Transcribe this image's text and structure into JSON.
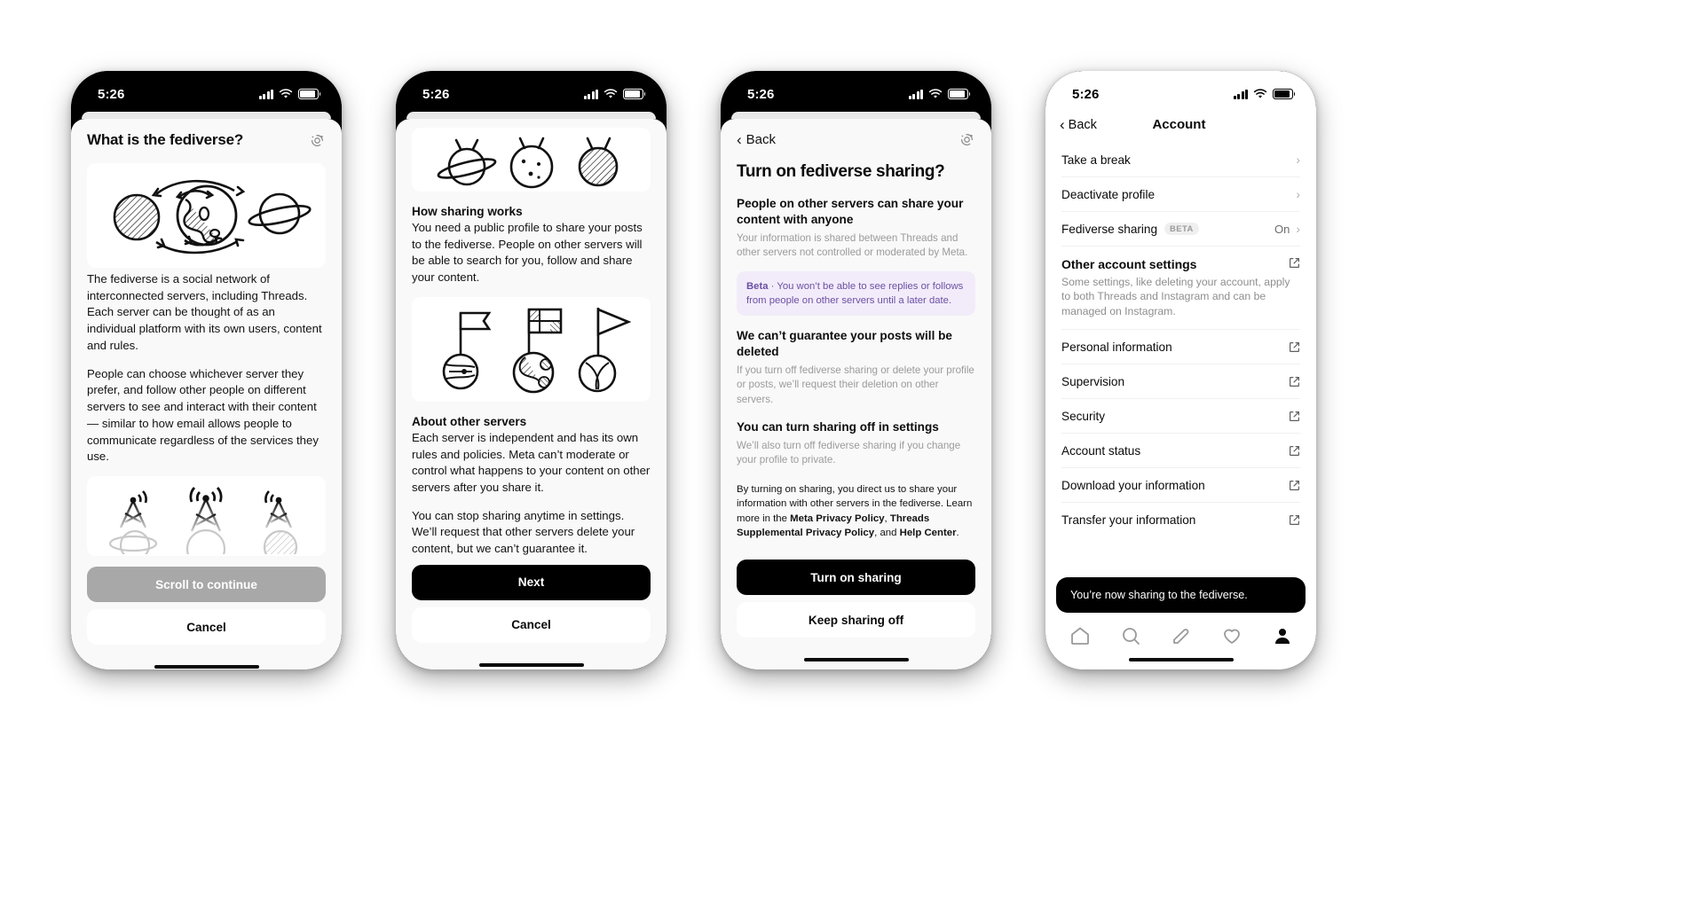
{
  "meta": {
    "status_time": "5:26",
    "accent_beta_bg": "#f2ecfa",
    "accent_beta_text": "#6c4fa3",
    "primary_button_bg": "#000000",
    "disabled_button_bg": "#a8a8a8"
  },
  "phone1": {
    "title": "What is the fediverse?",
    "icon": "fediverse-icon",
    "paragraphs": [
      "The fediverse is a social network of interconnected servers, including Threads. Each server can be thought of as an individual platform with its own users, content and rules.",
      "People can choose whichever server they prefer, and follow other people on different servers to see and interact with their content — similar to how email allows people to communicate regardless of the services they use."
    ],
    "primary_button": "Scroll to continue",
    "secondary_button": "Cancel"
  },
  "phone2": {
    "sections": [
      {
        "heading": "How sharing works",
        "body": "You need a public profile to share your posts to the fediverse. People on other servers will be able to search for you, follow and share your content."
      },
      {
        "heading": "About other servers",
        "body": "Each server is independent and has its own rules and policies. Meta can’t moderate or control what happens to your content on other servers after you share it."
      }
    ],
    "trailing_paragraph": "You can stop sharing anytime in settings. We’ll request that other servers delete your content, but we can’t guarantee it.",
    "primary_button": "Next",
    "secondary_button": "Cancel"
  },
  "phone3": {
    "back_label": "Back",
    "icon": "fediverse-icon",
    "title": "Turn on fediverse sharing?",
    "items": [
      {
        "heading": "People on other servers can share your content with anyone",
        "body": "Your information is shared between Threads and other servers not controlled or moderated by Meta."
      },
      {
        "heading": "We can’t guarantee your posts will be deleted",
        "body": "If you turn off fediverse sharing or delete your profile or posts, we’ll request their deletion on other servers."
      },
      {
        "heading": "You can turn sharing off in settings",
        "body": "We’ll also turn off fediverse sharing if you change your profile to private."
      }
    ],
    "beta_notice_prefix": "Beta",
    "beta_notice": " · You won’t be able to see replies or follows from people on other servers until a later date.",
    "legal_part1": "By turning on sharing, you direct us to share your information with other servers in the fediverse. Learn more in the ",
    "legal_link1": "Meta Privacy Policy",
    "legal_sep1": ", ",
    "legal_link2": "Threads Supplemental Privacy Policy",
    "legal_sep2": ", and ",
    "legal_link3": "Help Center",
    "legal_end": ".",
    "primary_button": "Turn on sharing",
    "secondary_button": "Keep sharing off"
  },
  "phone4": {
    "back_label": "Back",
    "nav_title": "Account",
    "rows": [
      {
        "label": "Take a break",
        "badge": "",
        "value": "",
        "accessory": "chevron-right-icon"
      },
      {
        "label": "Deactivate profile",
        "badge": "",
        "value": "",
        "accessory": "chevron-right-icon"
      },
      {
        "label": "Fediverse sharing",
        "badge": "BETA",
        "value": "On",
        "accessory": "chevron-right-icon"
      }
    ],
    "section": {
      "heading": "Other account settings",
      "description": "Some settings, like deleting your account, apply to both Threads and Instagram and can be managed on Instagram.",
      "accessory": "external-link-icon"
    },
    "links": [
      {
        "label": "Personal information",
        "accessory": "external-link-icon"
      },
      {
        "label": "Supervision",
        "accessory": "external-link-icon"
      },
      {
        "label": "Security",
        "accessory": "external-link-icon"
      },
      {
        "label": "Account status",
        "accessory": "external-link-icon"
      },
      {
        "label": "Download your information",
        "accessory": "external-link-icon"
      },
      {
        "label": "Transfer your information",
        "accessory": "external-link-icon"
      }
    ],
    "toast": "You’re now sharing to the fediverse.",
    "tabs": [
      {
        "name": "home-icon",
        "active": false
      },
      {
        "name": "search-icon",
        "active": false
      },
      {
        "name": "compose-icon",
        "active": false
      },
      {
        "name": "heart-icon",
        "active": false
      },
      {
        "name": "profile-icon",
        "active": true
      }
    ]
  }
}
